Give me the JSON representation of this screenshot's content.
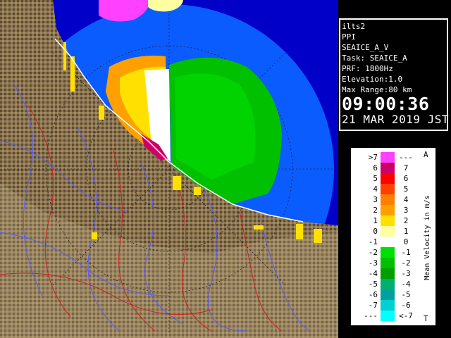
{
  "radar": {
    "site": "ilts2",
    "product": "PPI",
    "scan_name": "SEAICE_A_V",
    "task": "Task: SEAICE_A",
    "prf": "PRF: 1800Hz",
    "elevation": "Elevation:1.0",
    "max_range": "Max Range:80 km",
    "time": "09:00:36",
    "date": "21 MAR 2019 JST"
  },
  "legend": {
    "unit_label": "Mean Velocity in m/s",
    "corner_top": "A",
    "corner_bottom": "T",
    "entries": [
      {
        "left": ">7",
        "right": "---",
        "color": "#ff40ff"
      },
      {
        "left": "6",
        "right": "7",
        "color": "#cc0066"
      },
      {
        "left": "5",
        "right": "6",
        "color": "#ff0000"
      },
      {
        "left": "4",
        "right": "5",
        "color": "#ff4000"
      },
      {
        "left": "3",
        "right": "4",
        "color": "#ff8000"
      },
      {
        "left": "2",
        "right": "3",
        "color": "#ffa000"
      },
      {
        "left": "1",
        "right": "2",
        "color": "#ffe000"
      },
      {
        "left": "0",
        "right": "1",
        "color": "#ffffa0"
      },
      {
        "left": "-1",
        "right": "0",
        "color": "#ffffff"
      },
      {
        "left": "-2",
        "right": "-1",
        "color": "#00e000"
      },
      {
        "left": "-3",
        "right": "-2",
        "color": "#00c000"
      },
      {
        "left": "-4",
        "right": "-3",
        "color": "#00a000"
      },
      {
        "left": "-5",
        "right": "-4",
        "color": "#00b070"
      },
      {
        "left": "-6",
        "right": "-5",
        "color": "#00a0a0"
      },
      {
        "left": "-7",
        "right": "-6",
        "color": "#00d0d0"
      },
      {
        "left": "---",
        "right": "<-7",
        "color": "#00ffff"
      }
    ]
  },
  "colors": {
    "sea_range": "#0a5cff",
    "land": "#8a7550",
    "land_dark": "#5a4630",
    "outside_range": "#0000c8"
  }
}
